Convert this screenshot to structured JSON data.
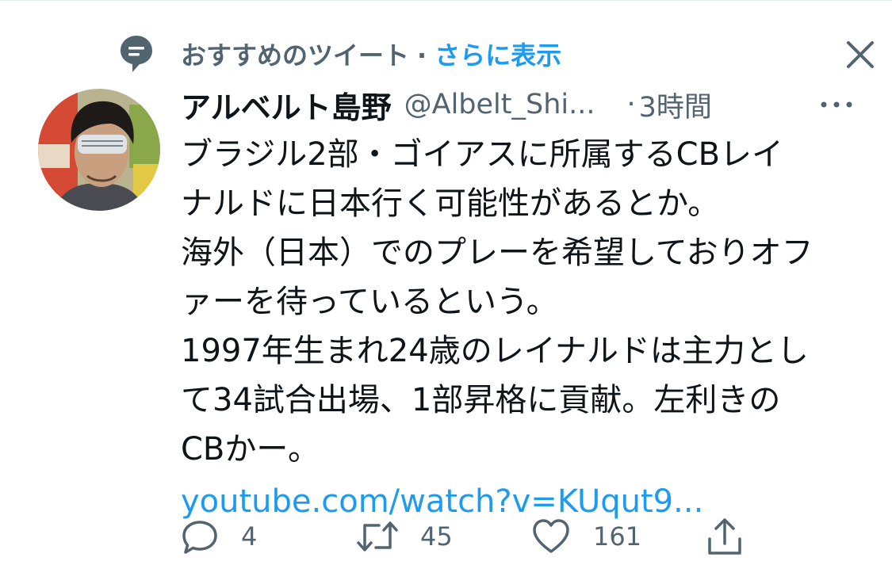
{
  "context": {
    "label": "おすすめのツイート",
    "separator": "·",
    "show_more": "さらに表示",
    "icon": "message-icon",
    "close_icon": "close-icon"
  },
  "tweet": {
    "author_name": "アルベルト島野",
    "author_handle": "@Albelt_Shi...",
    "time_separator": "·",
    "timestamp": "3時間",
    "more_icon": "more-horizontal-icon",
    "lines": [
      "ブラジル2部・ゴイアスに所属するCBレイ",
      "ナルドに日本行く可能性があるとか。",
      "海外（日本）でのプレーを希望しておりオフ",
      "ァーを待っているという。",
      "1997年生まれ24歳のレイナルドは主力とし",
      "て34試合出場、1部昇格に貢献。左利きの",
      "CBかー。"
    ],
    "link": "youtube.com/watch?v=KUqut9..."
  },
  "actions": {
    "reply_count": "4",
    "retweet_count": "45",
    "like_count": "161"
  },
  "colors": {
    "accent": "#1d9bf0",
    "secondary_text": "#536471",
    "primary_text": "#0f1419"
  }
}
